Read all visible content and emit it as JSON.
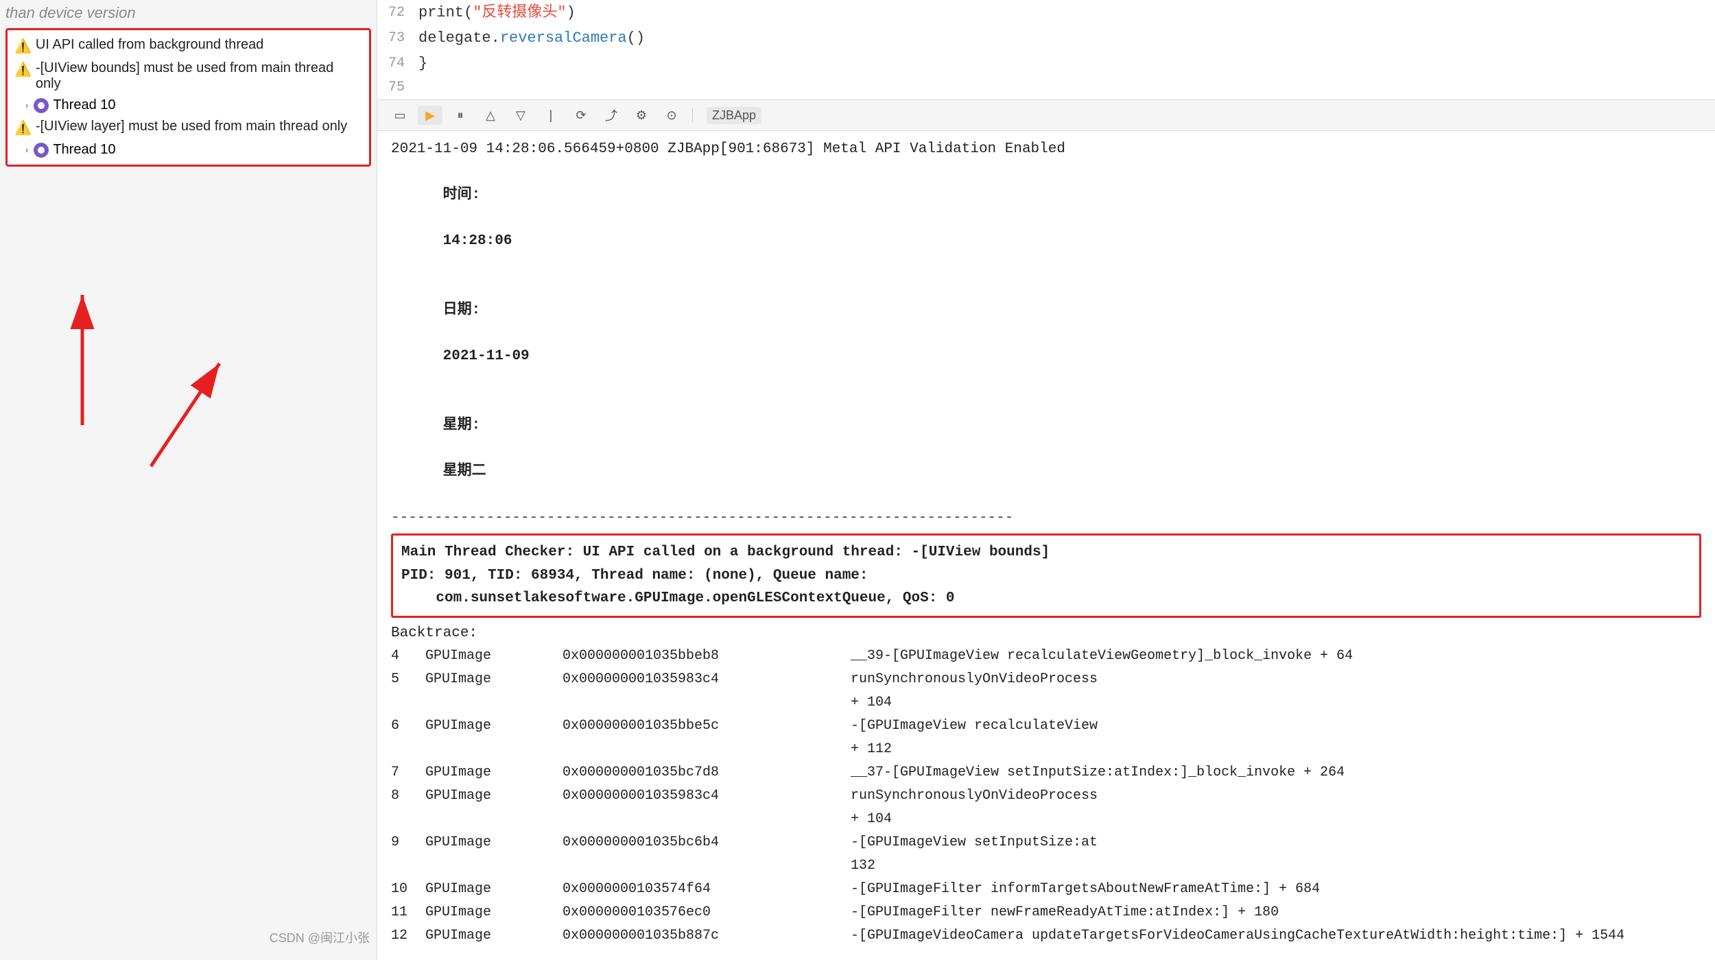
{
  "left": {
    "top_text": "than device version",
    "debug_box": {
      "warnings": [
        {
          "id": 1,
          "text": "UI API called from background thread",
          "thread": "Thread 10"
        },
        {
          "id": 2,
          "text": "-[UIView bounds] must be used from main thread only",
          "thread": "Thread 10"
        },
        {
          "id": 3,
          "text": "-[UIView layer] must be used from main thread only",
          "thread": "Thread 10"
        }
      ]
    },
    "watermark": "CSDN @闽江小张"
  },
  "right": {
    "code_lines": [
      {
        "num": "72",
        "content": "print(\"反转摄像头\")",
        "has_string": true,
        "string": "反转摄像头",
        "before": "print(",
        "after": ")"
      },
      {
        "num": "73",
        "content": "            delegate.reversalCamera()",
        "before": "            delegate.",
        "method": "reversalCamera",
        "after": "()"
      },
      {
        "num": "74",
        "content": "        }"
      },
      {
        "num": "75",
        "content": ""
      }
    ],
    "toolbar": {
      "label": "ZJBApp",
      "buttons": [
        "rect",
        "play-fill",
        "pause",
        "up-arrow",
        "down-arrow",
        "line",
        "loop",
        "share",
        "gear",
        "camera"
      ]
    },
    "console": {
      "header": "2021-11-09 14:28:06.566459+0800 ZJBApp[901:68673] Metal API Validation Enabled",
      "time_label": "时间:",
      "time_value": "14:28:06",
      "date_label": "日期:",
      "date_value": "2021-11-09",
      "weekday_label": "星期:",
      "weekday_value": "星期二",
      "separator": "------------------------------------------------------------------------",
      "error_box": {
        "line1": "Main Thread Checker: UI API called on a background thread: -[UIView bounds]",
        "line2": "PID: 901, TID: 68934, Thread name: (none), Queue name:",
        "line3": "    com.sunsetlakesoftware.GPUImage.openGLESContextQueue, QoS: 0"
      },
      "backtrace_label": "Backtrace:",
      "backtrace": [
        {
          "num": "4",
          "lib": "GPUImage",
          "addr": "0x000000001035bbeb8",
          "desc": "__39-[GPUImageView recalculateViewGeometry]_block_invoke + 64"
        },
        {
          "num": "5",
          "lib": "GPUImage",
          "addr": "0x000000001035983c4",
          "desc": "runSynchronouslyOnVideoProcess\n+ 104"
        },
        {
          "num": "6",
          "lib": "GPUImage",
          "addr": "0x000000001035bbe5c",
          "desc": "-[GPUImageView recalculateView\n+ 112"
        },
        {
          "num": "7",
          "lib": "GPUImage",
          "addr": "0x000000001035bc7d8",
          "desc": "__37-[GPUImageView setInputSize:atIndex:]_block_invoke + 264"
        },
        {
          "num": "8",
          "lib": "GPUImage",
          "addr": "0x000000001035983c4",
          "desc": "runSynchronouslyOnVideoProcess\n+ 104"
        },
        {
          "num": "9",
          "lib": "GPUImage",
          "addr": "0x000000001035bc6b4",
          "desc": "-[GPUImageView setInputSize:at\n132"
        },
        {
          "num": "10",
          "lib": "GPUImage",
          "addr": "0x0000000103574f64",
          "desc": "-[GPUImageFilter informTargetsAboutNewFrameAtTime:] + 684"
        },
        {
          "num": "11",
          "lib": "GPUImage",
          "addr": "0x0000000103576ec0",
          "desc": "-[GPUImageFilter newFrameReadyAtTime:atIndex:] + 180"
        },
        {
          "num": "12",
          "lib": "GPUImage",
          "addr": "0x000000001035b887c",
          "desc": "-[GPUImageVideoCamera updateTargetsForVideoCameraUsingCacheTextureAtWidth:height:time:] + 1544"
        }
      ]
    }
  }
}
